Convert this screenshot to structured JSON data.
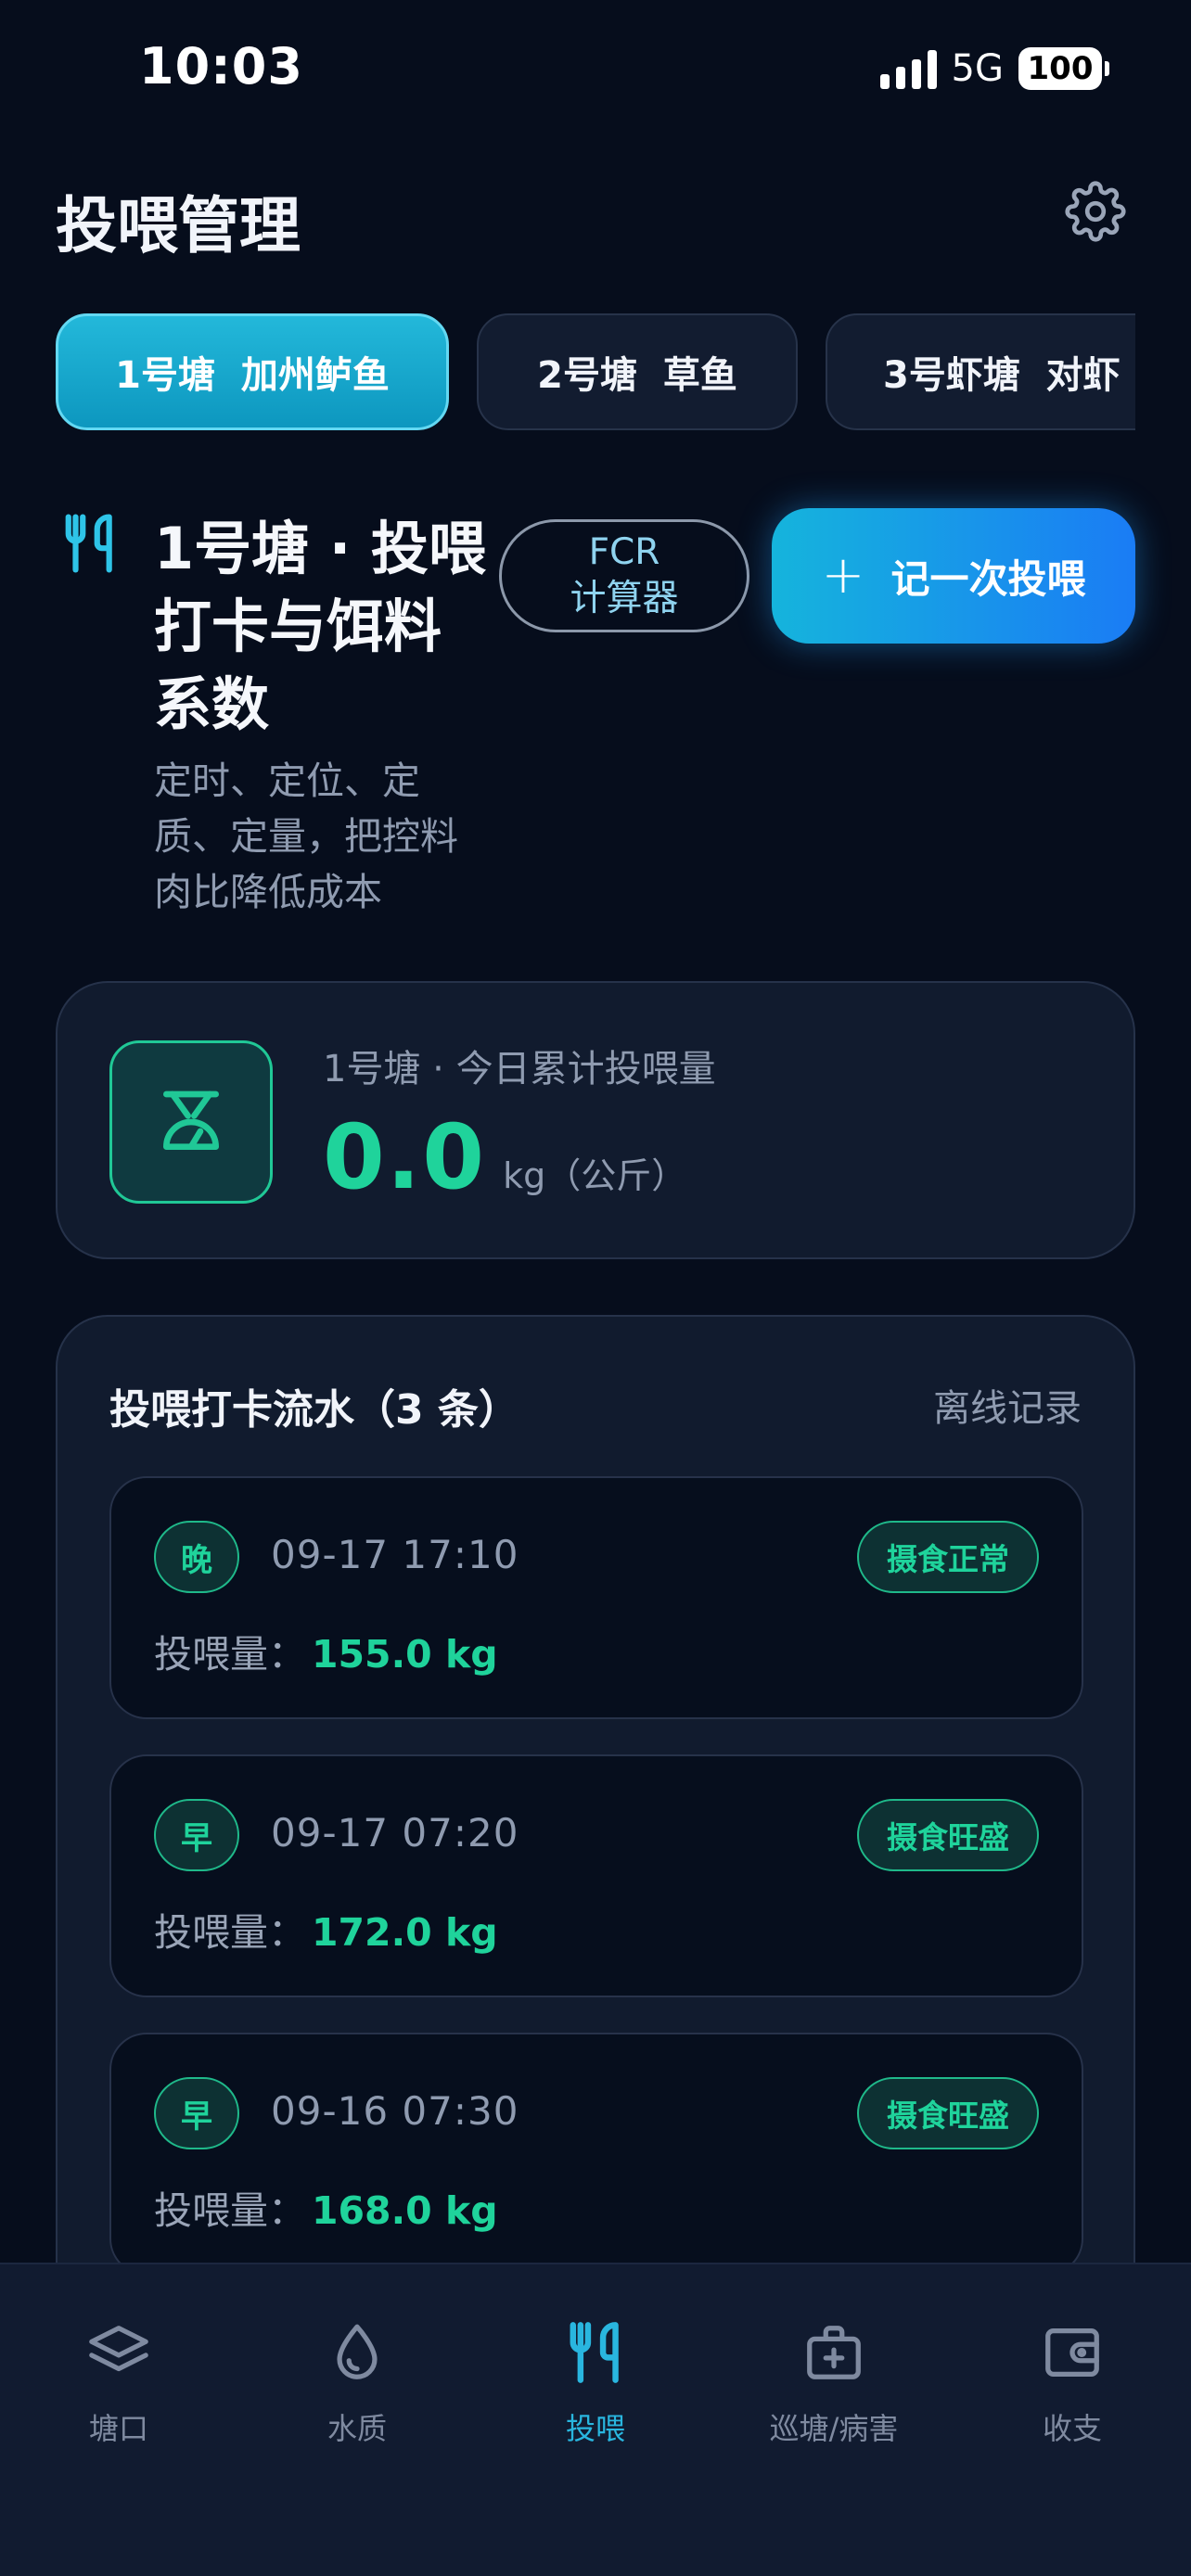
{
  "status_bar": {
    "time": "10:03",
    "network": "5G",
    "battery": "100"
  },
  "header": {
    "title": "投喂管理",
    "settings_icon": "gear-icon"
  },
  "ponds": {
    "tabs": [
      {
        "label": "1号塘  加州鲈鱼",
        "active": true
      },
      {
        "label": "2号塘  草鱼",
        "active": false
      },
      {
        "label": "3号虾塘  对虾",
        "active": false
      }
    ]
  },
  "section": {
    "icon": "fork-knife-icon",
    "title": "1号塘 · 投喂打卡与饵料系数",
    "description": "定时、定位、定质、定量，把控料肉比降低成本",
    "fcr_button": {
      "line1": "FCR",
      "line2": "计算器"
    },
    "add_button": {
      "plus": "+",
      "label": "记一次投喂"
    }
  },
  "today": {
    "icon": "scale-icon",
    "label": "1号塘 · 今日累计投喂量",
    "value": "0.0",
    "unit": "kg（公斤）"
  },
  "log": {
    "title": "投喂打卡流水（3 条）",
    "offline_link": "离线记录",
    "amount_label": "投喂量：",
    "entries": [
      {
        "tag": "晚",
        "time": "09-17 17:10",
        "status": "摄食正常",
        "amount": "155.0 kg"
      },
      {
        "tag": "早",
        "time": "09-17 07:20",
        "status": "摄食旺盛",
        "amount": "172.0 kg"
      },
      {
        "tag": "早",
        "time": "09-16 07:30",
        "status": "摄食旺盛",
        "amount": "168.0 kg"
      }
    ]
  },
  "nav": {
    "items": [
      {
        "label": "塘口",
        "icon": "layers-icon",
        "active": false
      },
      {
        "label": "水质",
        "icon": "water-drop-icon",
        "active": false
      },
      {
        "label": "投喂",
        "icon": "fork-knife-icon",
        "active": true
      },
      {
        "label": "巡塘/病害",
        "icon": "medical-kit-icon",
        "active": false
      },
      {
        "label": "收支",
        "icon": "wallet-icon",
        "active": false
      }
    ]
  },
  "colors": {
    "accent": "#1fd39b",
    "primary": "#15b4dc",
    "background": "#060d1c",
    "card": "#111b2e"
  }
}
